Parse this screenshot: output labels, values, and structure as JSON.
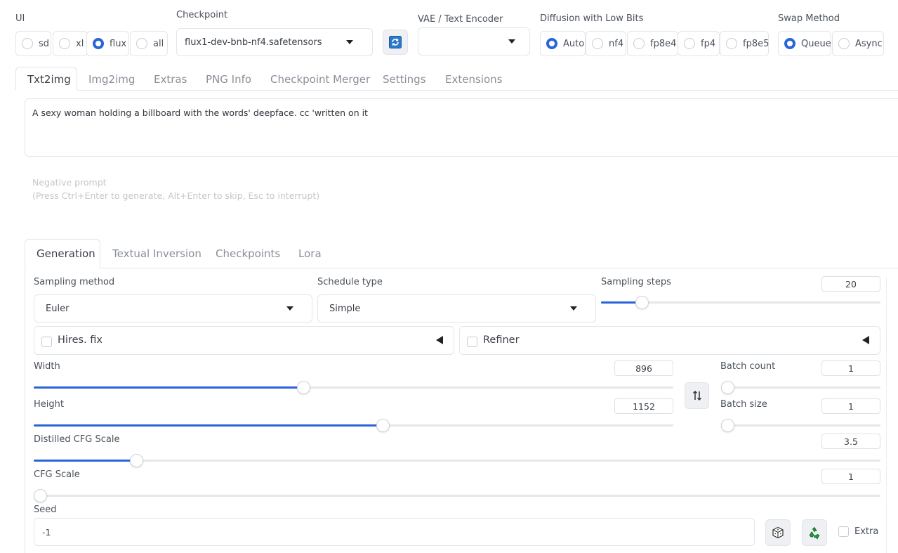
{
  "top": {
    "ui": {
      "label": "UI",
      "options": [
        "sd",
        "xl",
        "flux",
        "all"
      ],
      "selected": "flux"
    },
    "checkpoint": {
      "label": "Checkpoint",
      "value": "flux1-dev-bnb-nf4.safetensors"
    },
    "vae": {
      "label": "VAE / Text Encoder",
      "value": ""
    },
    "diffusion": {
      "label": "Diffusion with Low Bits",
      "options": [
        "Auto",
        "nf4",
        "fp8e4",
        "fp4",
        "fp8e5"
      ],
      "selected": "Auto"
    },
    "swap": {
      "label": "Swap Method",
      "options": [
        "Queue",
        "Async"
      ],
      "selected": "Queue"
    }
  },
  "main_tabs": [
    "Txt2img",
    "Img2img",
    "Extras",
    "PNG Info",
    "Checkpoint Merger",
    "Settings",
    "Extensions"
  ],
  "main_active": "Txt2img",
  "prompt": {
    "value": "A sexy woman holding a billboard with the words' deepface. cc 'written on it"
  },
  "negative": {
    "label": "Negative prompt",
    "hint": "(Press Ctrl+Enter to generate, Alt+Enter to skip, Esc to interrupt)"
  },
  "sub_tabs": [
    "Generation",
    "Textual Inversion",
    "Checkpoints",
    "Lora"
  ],
  "sub_active": "Generation",
  "gen": {
    "sampling_method": {
      "label": "Sampling method",
      "value": "Euler"
    },
    "schedule_type": {
      "label": "Schedule type",
      "value": "Simple"
    },
    "sampling_steps": {
      "label": "Sampling steps",
      "value": "20",
      "fraction": 0.146
    },
    "hires": {
      "label": "Hires. fix"
    },
    "refiner": {
      "label": "Refiner"
    },
    "width": {
      "label": "Width",
      "value": "896",
      "fraction": 0.421
    },
    "height": {
      "label": "Height",
      "value": "1152",
      "fraction": 0.546
    },
    "batch_count": {
      "label": "Batch count",
      "value": "1",
      "fraction": 0.0
    },
    "batch_size": {
      "label": "Batch size",
      "value": "1",
      "fraction": 0.0
    },
    "distilled_cfg": {
      "label": "Distilled CFG Scale",
      "value": "3.5",
      "fraction": 0.121
    },
    "cfg": {
      "label": "CFG Scale",
      "value": "1",
      "fraction": 0.0
    },
    "seed": {
      "label": "Seed",
      "value": "-1",
      "extra_label": "Extra"
    }
  },
  "colors": {
    "accent": "#2b63d9",
    "recycle": "#1e9a3a"
  },
  "icons": [
    "refresh-icon",
    "swap-dimensions-icon",
    "dice-icon",
    "recycle-icon",
    "checkbox-icon",
    "collapse-triangle-icon"
  ]
}
